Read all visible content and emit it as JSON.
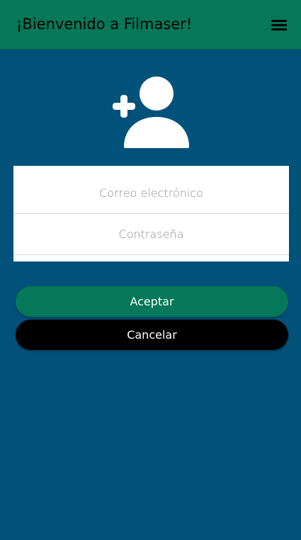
{
  "header": {
    "title": "¡Bienvenido a Filmaser!",
    "menu_icon": "hamburger-menu-icon"
  },
  "hero": {
    "icon": "user-add-icon"
  },
  "form": {
    "email_placeholder": "Correo electrónico",
    "password_placeholder": "Contraseña"
  },
  "buttons": {
    "accept_label": "Aceptar",
    "cancel_label": "Cancelar"
  },
  "colors": {
    "background": "#00527a",
    "header": "#047858",
    "accept_button": "#047858",
    "cancel_button": "#000000",
    "card": "#ffffff"
  }
}
